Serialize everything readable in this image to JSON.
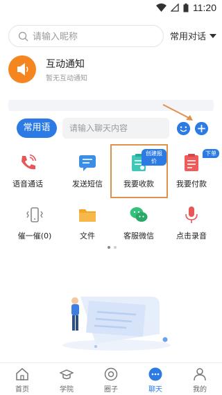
{
  "status": {
    "time": "11:20"
  },
  "search": {
    "placeholder": "请输入昵称",
    "common_dialogs": "常用对话"
  },
  "notice": {
    "title": "互动通知",
    "subtitle": "暂无互动通知"
  },
  "quick": {
    "button": "常用语",
    "placeholder": "请输入聊天内容"
  },
  "grid": {
    "items": [
      {
        "label": "语音通话",
        "icon": "phone-icon"
      },
      {
        "label": "发送短信",
        "icon": "sms-icon"
      },
      {
        "label": "我要收款",
        "icon": "receipt-icon",
        "badge": "创建报价"
      },
      {
        "label": "我要付款",
        "icon": "payment-icon",
        "badge": "下单"
      },
      {
        "label": "催一催(0)",
        "icon": "vibrate-icon"
      },
      {
        "label": "文件",
        "icon": "folder-icon"
      },
      {
        "label": "客服微信",
        "icon": "wechat-icon"
      },
      {
        "label": "点击录音",
        "icon": "microphone-icon"
      }
    ]
  },
  "tabs": [
    {
      "label": "首页",
      "icon": "home-icon"
    },
    {
      "label": "学院",
      "icon": "graduation-cap-icon"
    },
    {
      "label": "圈子",
      "icon": "at-circle-icon"
    },
    {
      "label": "聊天",
      "icon": "chat-bubble-icon",
      "active": true
    },
    {
      "label": "我的",
      "icon": "person-icon"
    }
  ],
  "colors": {
    "accent": "#2c7be5",
    "orange": "#f5861f",
    "highlight": "#e0914a"
  }
}
